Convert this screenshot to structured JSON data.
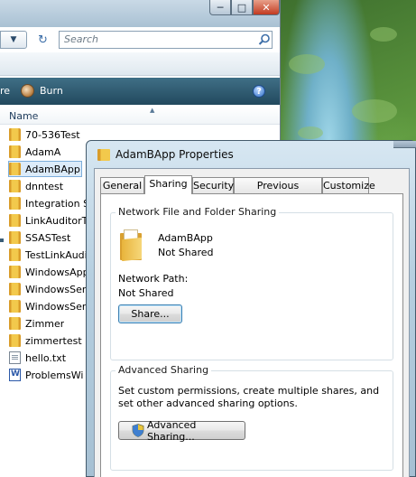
{
  "explorer": {
    "search_placeholder": "Search",
    "toolbar": {
      "share_label": "re",
      "burn_label": "Burn",
      "help_glyph": "?"
    },
    "column_header": "Name",
    "files": [
      {
        "name": "70-536Test",
        "type": "folder"
      },
      {
        "name": "AdamA",
        "type": "folder"
      },
      {
        "name": "AdamBApp",
        "type": "folder",
        "selected": true
      },
      {
        "name": "dnntest",
        "type": "folder"
      },
      {
        "name": "Integration S",
        "type": "folder"
      },
      {
        "name": "LinkAuditorT",
        "type": "folder"
      },
      {
        "name": "SSASTest",
        "type": "folder"
      },
      {
        "name": "TestLinkAudi",
        "type": "folder"
      },
      {
        "name": "WindowsApp",
        "type": "folder"
      },
      {
        "name": "WindowsSer",
        "type": "folder"
      },
      {
        "name": "WindowsSer",
        "type": "folder"
      },
      {
        "name": "Zimmer",
        "type": "folder"
      },
      {
        "name": "zimmertest",
        "type": "folder"
      },
      {
        "name": "hello.txt",
        "type": "text-file"
      },
      {
        "name": "ProblemsWi",
        "type": "word-document"
      }
    ]
  },
  "dialog": {
    "title": "AdamBApp Properties",
    "tabs": [
      {
        "label": "General"
      },
      {
        "label": "Sharing",
        "active": true
      },
      {
        "label": "Security"
      },
      {
        "label": "Previous Versions"
      },
      {
        "label": "Customize"
      }
    ],
    "network_group": {
      "title": "Network File and Folder Sharing",
      "folder_name": "AdamBApp",
      "folder_status": "Not Shared",
      "network_path_label": "Network Path:",
      "network_path_value": "Not Shared",
      "share_button": "Share..."
    },
    "advanced_group": {
      "title": "Advanced Sharing",
      "description": "Set custom permissions, create multiple shares, and set other advanced sharing options.",
      "button": "Advanced Sharing..."
    }
  }
}
